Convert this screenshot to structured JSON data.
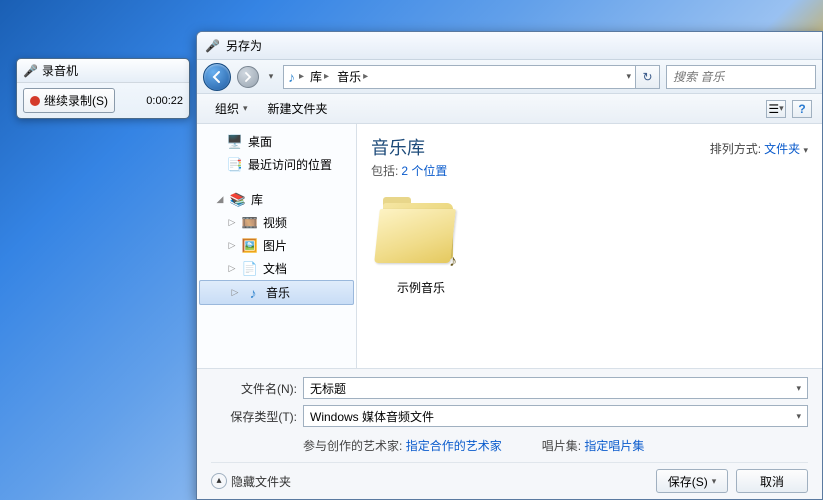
{
  "recorder": {
    "title": "录音机",
    "button_label": "继续录制(S)",
    "time": "0:00:22"
  },
  "saveas": {
    "title": "另存为",
    "nav": {
      "crumb_library": "库",
      "crumb_music": "音乐"
    },
    "search_placeholder": "搜索 音乐",
    "toolbar": {
      "organize": "组织",
      "new_folder": "新建文件夹"
    },
    "tree": {
      "desktop": "桌面",
      "recent": "最近访问的位置",
      "library": "库",
      "videos": "视频",
      "pictures": "图片",
      "documents": "文档",
      "music": "音乐"
    },
    "content": {
      "library_title": "音乐库",
      "includes_label": "包括:",
      "includes_link": "2 个位置",
      "arrange_label": "排列方式:",
      "arrange_value": "文件夹",
      "folder_name": "示例音乐"
    },
    "form": {
      "filename_label": "文件名(N):",
      "filename_value": "无标题",
      "filetype_label": "保存类型(T):",
      "filetype_value": "Windows 媒体音频文件",
      "artists_label": "参与创作的艺术家:",
      "artists_link": "指定合作的艺术家",
      "album_label": "唱片集:",
      "album_link": "指定唱片集",
      "hide_folders": "隐藏文件夹",
      "save_btn": "保存(S)",
      "cancel_btn": "取消"
    }
  }
}
